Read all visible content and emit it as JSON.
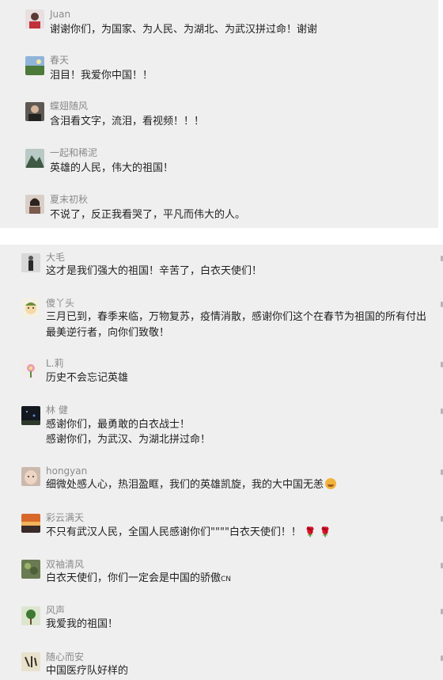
{
  "comments_top": [
    {
      "name": "Juan",
      "text": "谢谢你们，为国家、为人民、为湖北、为武汉拼过命！谢谢",
      "avatar": "avatar-person-red"
    },
    {
      "name": "春天",
      "text": "泪目！我爱你中国！！",
      "avatar": "avatar-landscape"
    },
    {
      "name": "蝶翅随风",
      "text": "含泪看文字，流泪，看视频！！！",
      "avatar": "avatar-person-dark"
    },
    {
      "name": "一起和稀泥",
      "text": "英雄的人民，伟大的祖国！",
      "avatar": "avatar-mountain"
    },
    {
      "name": "夏末初秋",
      "text": "不说了，反正我看哭了，平凡而伟大的人。",
      "avatar": "avatar-woman"
    }
  ],
  "comments_bottom": [
    {
      "name": "大毛",
      "lines": [
        "这才是我们强大的祖国！辛苦了，白衣天使们！"
      ],
      "avatar": "avatar-standing-person"
    },
    {
      "name": "傻丫头",
      "lines": [
        "三月已到，春季来临，万物复苏，疫情消散，感谢你们这个在春节为祖国的所有付出",
        "最美逆行者，向你们致敬！"
      ],
      "avatar": "avatar-cartoon"
    },
    {
      "name": "L.莉",
      "lines": [
        "历史不会忘记英雄"
      ],
      "avatar": "avatar-flower"
    },
    {
      "name": "林 健",
      "lines": [
        "感谢你们，最勇敢的白衣战士！",
        "感谢你们，为武汉、为湖北拼过命！"
      ],
      "avatar": "avatar-night"
    },
    {
      "name": "hongyan",
      "lines": [
        "细微处感人心，热泪盈眶，我们的英雄凯旋，我的大中国无恙"
      ],
      "emoji": "laugh-emoji",
      "avatar": "avatar-face"
    },
    {
      "name": "彩云满天",
      "lines": [
        "不只有武汉人民，全国人民感谢你们\"\"\"\"白衣天使们！！"
      ],
      "emoji": "rose-emoji",
      "avatar": "avatar-sunset"
    },
    {
      "name": "双袖清风",
      "lines": [
        "白衣天使们，你们一定会是中国的骄傲"
      ],
      "suffix": "CN",
      "avatar": "avatar-plant"
    },
    {
      "name": "风声",
      "lines": [
        "我爱我的祖国！"
      ],
      "avatar": "avatar-green"
    },
    {
      "name": "随心而安",
      "lines": [
        "中国医疗队好样的"
      ],
      "avatar": "avatar-calligraphy"
    }
  ]
}
